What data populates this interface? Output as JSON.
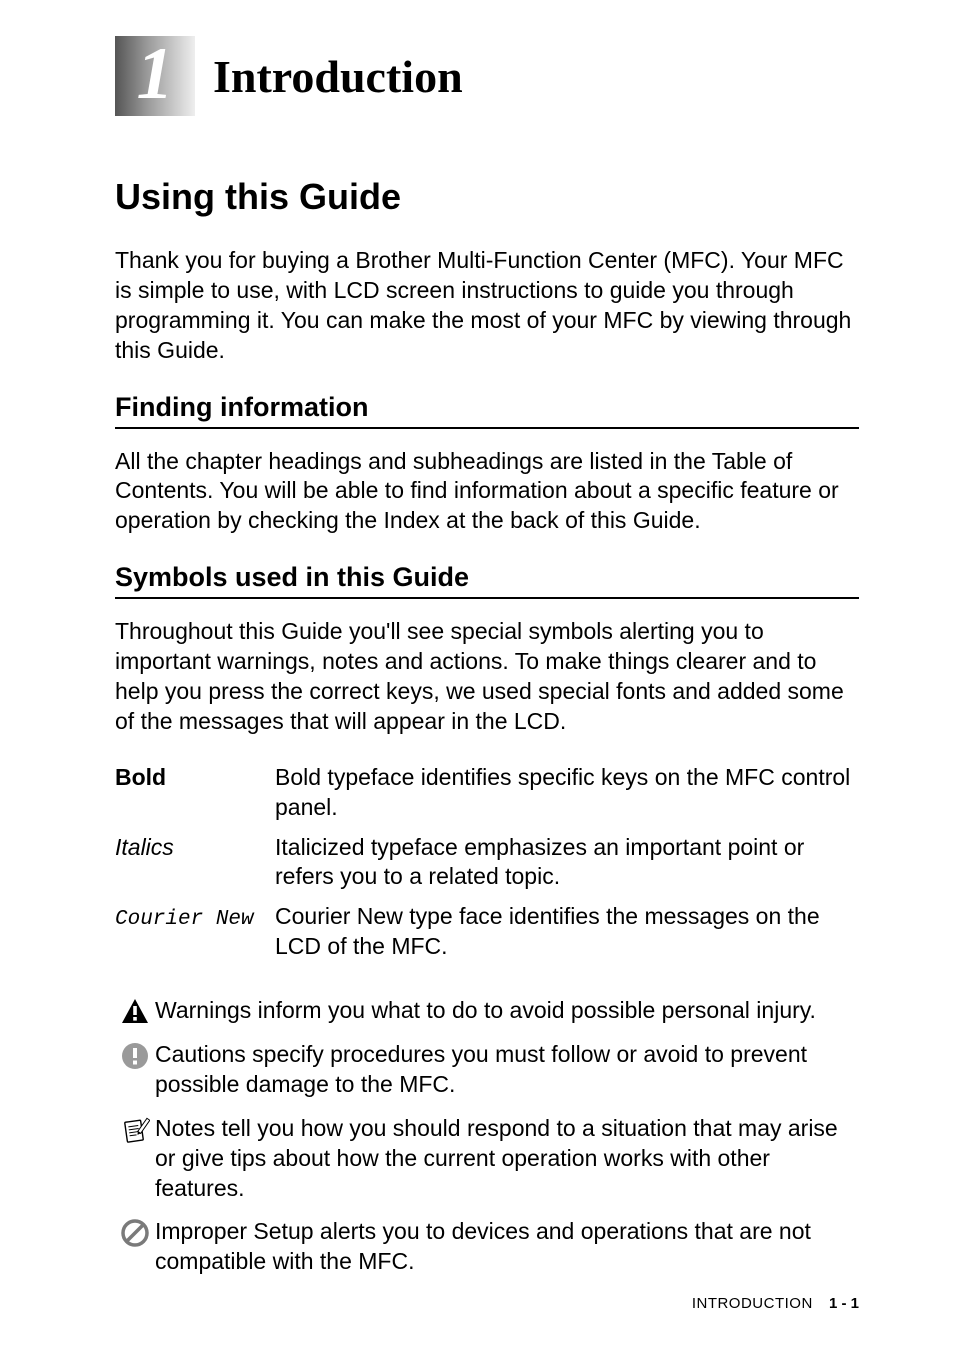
{
  "chapter": {
    "number": "1",
    "title": "Introduction"
  },
  "section": {
    "title": "Using this Guide",
    "intro": "Thank you for buying a Brother Multi-Function Center (MFC). Your MFC is simple to use, with LCD screen instructions to guide you through programming it. You can make the most of your MFC by viewing through this Guide."
  },
  "subsections": {
    "finding": {
      "title": "Finding information",
      "body": "All the chapter headings and subheadings are listed in the Table of Contents. You will be able to find information about a specific feature or operation by checking the Index at the back of this Guide."
    },
    "symbols": {
      "title": "Symbols used in this Guide",
      "body": "Throughout this Guide you'll see special symbols alerting you to important warnings, notes and actions. To make things clearer and to help you press the correct keys, we used special fonts and added some of the messages that will appear in the LCD."
    }
  },
  "typeface_defs": [
    {
      "term": "Bold",
      "term_class": "bold",
      "desc": "Bold typeface identifies specific keys on the MFC control panel."
    },
    {
      "term": "Italics",
      "term_class": "italic",
      "desc": "Italicized typeface emphasizes an important point or refers you to a related topic."
    },
    {
      "term": "Courier New",
      "term_class": "mono",
      "desc": "Courier New type face identifies the messages on the LCD of the MFC."
    }
  ],
  "symbol_defs": [
    {
      "icon": "warning",
      "desc": "Warnings inform you what to do to avoid possible personal injury."
    },
    {
      "icon": "caution",
      "desc": "Cautions specify procedures you must follow or avoid to prevent possible damage to the MFC."
    },
    {
      "icon": "note",
      "desc": "Notes tell you how you should respond to a situation that may arise or give tips about how the current operation works with other features."
    },
    {
      "icon": "improper",
      "desc": "Improper Setup alerts you to devices and operations that are not compatible with the MFC."
    }
  ],
  "footer": {
    "label": "INTRODUCTION",
    "page": "1 - 1"
  }
}
